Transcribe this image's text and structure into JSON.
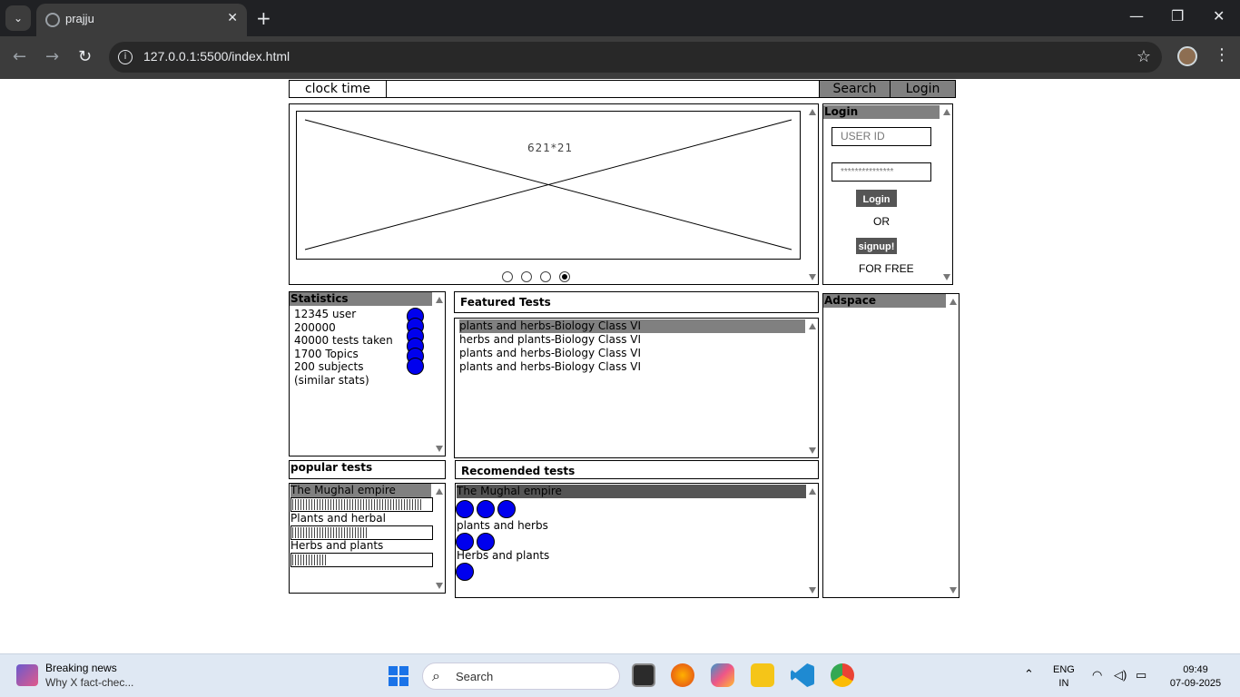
{
  "browser": {
    "tab_title": "prajju",
    "url": "127.0.0.1:5500/index.html",
    "icons": [
      "tab-search-icon",
      "close-icon",
      "new-tab-icon",
      "minimize-icon",
      "maximize-icon",
      "close-window-icon",
      "back-icon",
      "forward-icon",
      "reload-icon",
      "info-icon",
      "star-icon",
      "menu-icon"
    ]
  },
  "header": {
    "clock": "clock time",
    "search_label": "Search",
    "login_label": "Login"
  },
  "carousel": {
    "placeholder": "621*21",
    "slides": 4,
    "active_slide": 4
  },
  "login_panel": {
    "title": "Login",
    "userid_placeholder": "USER ID",
    "password_value": "***************",
    "login_button": "Login",
    "or_text": "OR",
    "signup_button": "signup!",
    "free_text": "FOR FREE"
  },
  "statistics": {
    "title": "Statistics",
    "items": [
      "12345 user",
      "200000",
      "40000 tests taken",
      "1700 Topics",
      "200 subjects",
      "(similar stats)"
    ]
  },
  "featured": {
    "title": "Featured Tests",
    "items": [
      "plants and herbs-Biology Class VI",
      "herbs and plants-Biology Class VI",
      "plants and herbs-Biology Class VI",
      "plants and herbs-Biology Class VI"
    ]
  },
  "popular": {
    "title": "popular tests",
    "items": [
      {
        "label": "The Mughal empire",
        "progress": 0.94
      },
      {
        "label": "Plants and herbal",
        "progress": 0.55
      },
      {
        "label": "Herbs and plants",
        "progress": 0.24
      }
    ]
  },
  "recommended": {
    "title": "Recomended tests",
    "items": [
      {
        "label": "The Mughal empire",
        "rating": 3
      },
      {
        "label": "plants and herbs",
        "rating": 2
      },
      {
        "label": "Herbs and plants",
        "rating": 1
      }
    ]
  },
  "adspace": {
    "title": "Adspace"
  },
  "taskbar": {
    "news_title": "Breaking news",
    "news_sub": "Why X fact-chec...",
    "search": "Search",
    "lang_top": "ENG",
    "lang_bottom": "IN",
    "time": "09:49",
    "date": "07-09-2025"
  },
  "colors": {
    "accent_gray": "#808080",
    "circle_blue": "#0000ee",
    "chrome_dark": "#202124"
  }
}
